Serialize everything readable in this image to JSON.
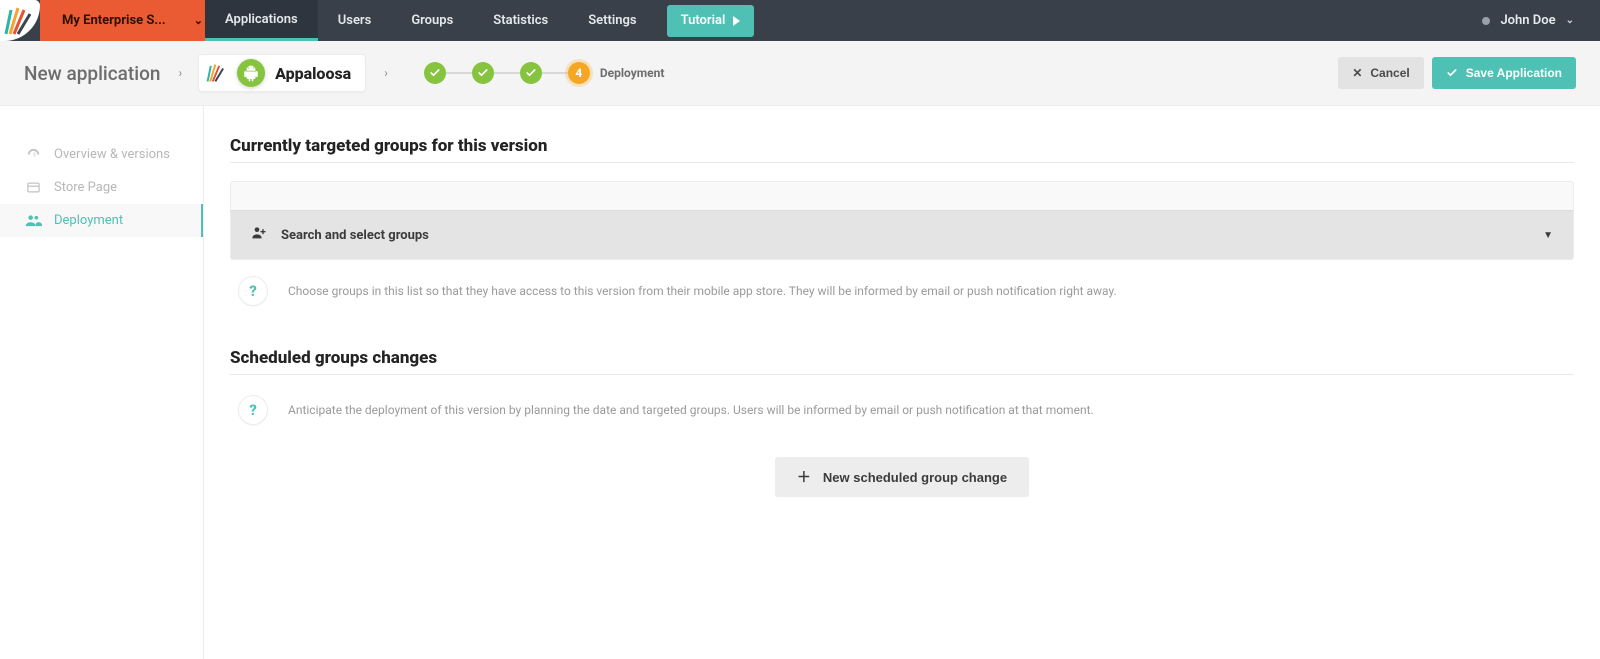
{
  "org": {
    "name": "My Enterprise S..."
  },
  "nav": {
    "applications": "Applications",
    "users": "Users",
    "groups": "Groups",
    "statistics": "Statistics",
    "settings": "Settings",
    "tutorial": "Tutorial"
  },
  "user": {
    "name": "John Doe"
  },
  "breadcrumb": {
    "root": "New application",
    "app_name": "Appaloosa"
  },
  "wizard": {
    "current_number": "4",
    "current_label": "Deployment"
  },
  "actions": {
    "cancel": "Cancel",
    "save": "Save Application"
  },
  "sidebar": {
    "overview": "Overview & versions",
    "store": "Store Page",
    "deployment": "Deployment"
  },
  "sections": {
    "targeted_title": "Currently targeted groups for this version",
    "group_select_label": "Search and select groups",
    "targeted_help": "Choose groups in this list so that they have access to this version from their mobile app store. They will be informed by email or push notification right away.",
    "scheduled_title": "Scheduled groups changes",
    "scheduled_help": "Anticipate the deployment of this version by planning the date and targeted groups. Users will be informed by email or push notification at that moment.",
    "new_schedule_btn": "New scheduled group change"
  }
}
